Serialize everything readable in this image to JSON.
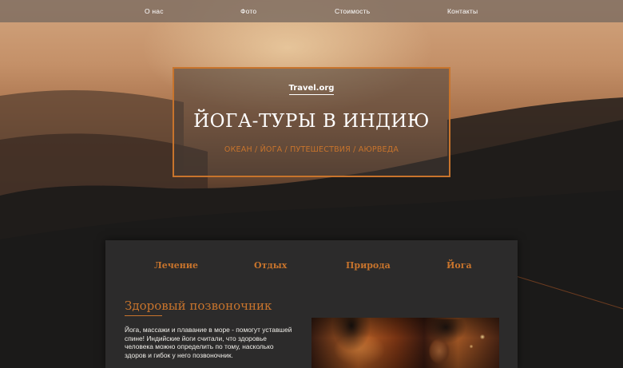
{
  "nav": {
    "items": [
      {
        "label": "О нас"
      },
      {
        "label": "Фото"
      },
      {
        "label": "Стоимость"
      },
      {
        "label": "Контакты"
      }
    ]
  },
  "hero": {
    "brand": "Travel.org",
    "title": "ЙОГА-ТУРЫ В ИНДИЮ",
    "subtitle": "ОКЕАН / ЙОГА / ПУТЕШЕСТВИЯ / АЮРВЕДА"
  },
  "tabs": {
    "items": [
      {
        "label": "Лечение"
      },
      {
        "label": "Отдых"
      },
      {
        "label": "Природа"
      },
      {
        "label": "Йога"
      }
    ]
  },
  "content": {
    "section_title": "Здоровый позвоночник",
    "text": "Йога, массажи и плавание в море - помогут уставшей спине! Индийские йоги считали, что здоровье человека можно определить по тому, насколько здоров и гибок у него позвоночник."
  },
  "colors": {
    "accent": "#c8742c",
    "card_bg": "#2c2b2b",
    "nav_bg": "#78695f"
  }
}
